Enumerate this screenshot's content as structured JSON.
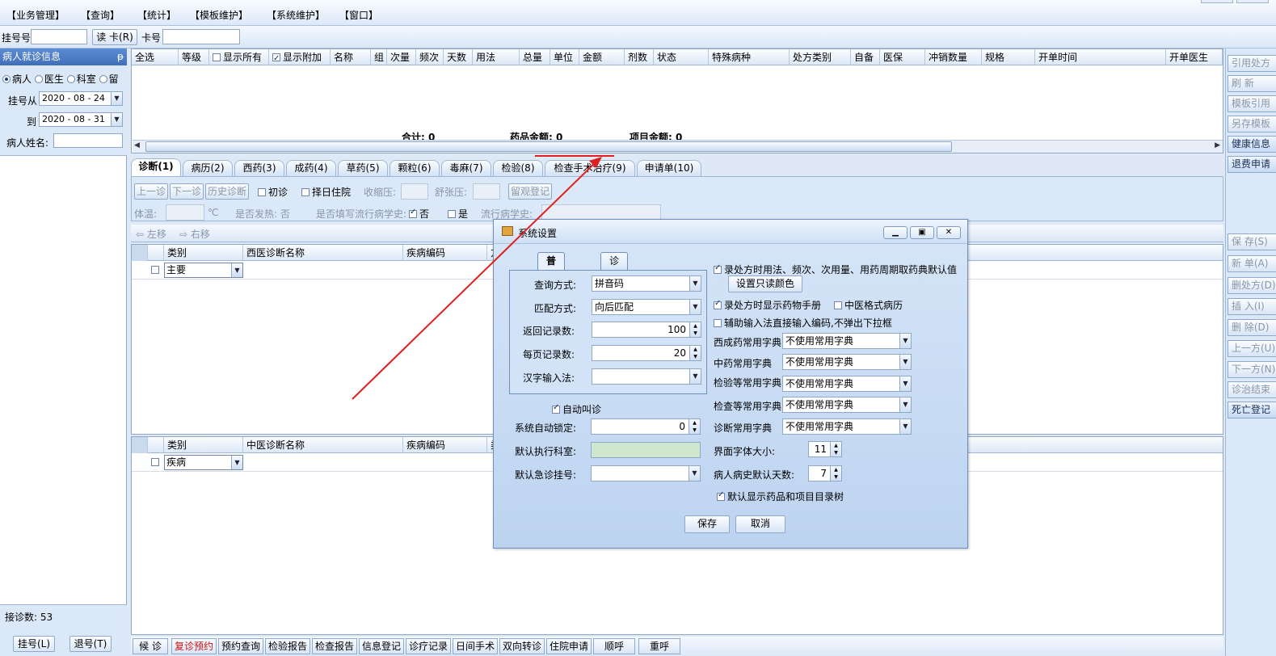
{
  "menu": [
    "【业务管理】",
    "【查询】",
    "【统计】",
    "【模板维护】",
    "【系统维护】",
    "【窗口】"
  ],
  "toolbar": {
    "reg_no_label": "挂号号",
    "read_card": "读 卡(R)",
    "card_no_label": "卡号",
    "reg_no_value": "",
    "card_no_value": ""
  },
  "left": {
    "title": "病人就诊信息",
    "pin": "ᵽ",
    "radios": [
      "病人",
      "医生",
      "科室",
      "留"
    ],
    "date_from_label": "挂号从",
    "date_from": "2020 - 08 - 24",
    "date_to_label": "到",
    "date_to": "2020 - 08 - 31",
    "name_label": "病人姓名:",
    "visit_count": "接诊数: 53",
    "buttons": [
      "挂号(L)",
      "退号(T)"
    ]
  },
  "rx_grid": {
    "columns": [
      "全选",
      "等级",
      "显示所有",
      "显示附加",
      "名称",
      "组",
      "次量",
      "频次",
      "天数",
      "用法",
      "总量",
      "单位",
      "金额",
      "剂数",
      "状态",
      "特殊病种",
      "处方类别",
      "自备",
      "医保",
      "冲销数量",
      "规格",
      "开单时间",
      "开单医生"
    ],
    "totals": [
      {
        "label": "合计:",
        "value": "0"
      },
      {
        "label": "药品金额:",
        "value": "0"
      },
      {
        "label": "项目金额:",
        "value": "0"
      }
    ]
  },
  "tabs": [
    "诊断(1)",
    "病历(2)",
    "西药(3)",
    "成药(4)",
    "草药(5)",
    "颗粒(6)",
    "毒麻(7)",
    "检验(8)",
    "检查手术治疗(9)",
    "申请单(10)"
  ],
  "diag_panel": {
    "buttons": [
      "上一诊",
      "下一诊",
      "历史诊断",
      "留观登记"
    ],
    "first_visit": "初诊",
    "select_day": "择日住院",
    "systolic": "收缩压:",
    "diastolic": "舒张压:",
    "temp": "体温:",
    "temp_unit": "℃",
    "fever": "是否发热: 否",
    "epi_question": "是否填写流行病学史:",
    "no": "否",
    "yes": "是",
    "epi_history": "流行病学史:"
  },
  "move": {
    "left": "左移",
    "right": "右移"
  },
  "western_grid": {
    "columns": [
      "类别",
      "西医诊断名称",
      "疾病编码",
      "方"
    ],
    "row_type": "主要"
  },
  "chinese_grid": {
    "columns": [
      "类别",
      "中医诊断名称",
      "疾病编码",
      "类"
    ],
    "row_type": "疾病"
  },
  "right_buttons": [
    "引用处方",
    "刷 新",
    "模板引用",
    "另存模板",
    "健康信息",
    "退费申请",
    "保 存(S)",
    "新 单(A)",
    "删处方(D)",
    "插 入(I)",
    "删 除(D)",
    "上一方(U)",
    "下一方(N)",
    "诊治结束",
    "死亡登记"
  ],
  "bottom_buttons": [
    "候 诊",
    "复诊预约",
    "预约查询",
    "检验报告",
    "检查报告",
    "信息登记",
    "诊疗记录",
    "日间手术",
    "双向转诊",
    "住院申请",
    "顺呼",
    "重呼"
  ],
  "dialog": {
    "title": "系统设置",
    "tabs": [
      "普通输入法",
      "诊断输入法"
    ],
    "query_label": "查询方式:",
    "query_value": "拼音码",
    "match_label": "匹配方式:",
    "match_value": "向后匹配",
    "return_label": "返回记录数:",
    "return_value": "100",
    "page_label": "每页记录数:",
    "page_value": "20",
    "hanzi_label": "汉字输入法:",
    "auto_call": "自动叫诊",
    "auto_lock_label": "系统自动锁定:",
    "auto_lock_value": "0",
    "default_dept_label": "默认执行科室:",
    "default_er_label": "默认急诊挂号:",
    "opt_default_dict": "录处方时用法、频次、次用量、用药周期取药典默认值",
    "set_readonly_color": "设置只读颜色",
    "opt_show_manual": "录处方时显示药物手册",
    "opt_tcm_format": "中医格式病历",
    "opt_direct_code": "辅助输入法直接输入编码,不弹出下拉框",
    "dict_rows": [
      {
        "label": "西成药常用字典",
        "value": "不使用常用字典"
      },
      {
        "label": "中药常用字典",
        "value": "不使用常用字典"
      },
      {
        "label": "检验等常用字典",
        "value": "不使用常用字典"
      },
      {
        "label": "检查等常用字典",
        "value": "不使用常用字典"
      },
      {
        "label": "诊断常用字典",
        "value": "不使用常用字典"
      }
    ],
    "font_size_label": "界面字体大小:",
    "font_size_value": "11",
    "history_days_label": "病人病史默认天数:",
    "history_days_value": "7",
    "opt_show_tree": "默认显示药品和项目目录树",
    "save": "保存",
    "cancel": "取消"
  },
  "colors": {
    "annotation_arrow": "#e02020",
    "header_blue": "#4a7cc4"
  }
}
